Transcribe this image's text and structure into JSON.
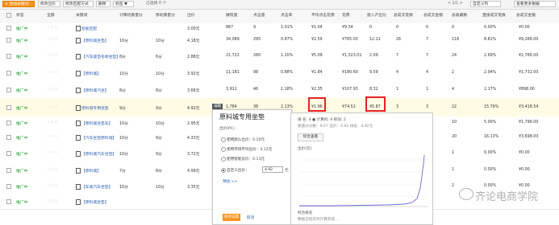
{
  "toolbar": {
    "buttons": [
      "+ 添加关键词",
      "修改出价",
      "修改匹配方式",
      "删除",
      "标签 ▼"
    ],
    "selected": "已选择 0 个",
    "pager": "< 1/1 >",
    "custom_col": "自定义列",
    "more_data": "查看更多数据"
  },
  "columns": [
    "状态",
    "全部",
    "关键词",
    "计算机质量分",
    "移动质量分",
    "出价",
    "展现量",
    "点击量",
    "点击率",
    "平均点击花费",
    "花费",
    "投入产出比",
    "总成交笔数",
    "总成交金额",
    "总收藏数",
    "直接成交笔数",
    "总成交金额"
  ],
  "rows": [
    {
      "status": "推广中",
      "stars": "☆☆☆",
      "keyword": "智能匹配",
      "pc": "",
      "mob": "",
      "bid": "3.00元",
      "imp": "887",
      "clk": "9",
      "ctr": "1.01%",
      "cpc": "¥1.04",
      "cost": "¥9.34",
      "roi": "0",
      "orders": "0",
      "gmv": "0",
      "fav": "0",
      "direct": "0.00%",
      "directgmv": "¥0.00"
    },
    {
      "status": "推广中",
      "stars": "☆☆☆",
      "keyword": "【原料城坐垫】",
      "pc": "10分",
      "mob": "10分",
      "bid": "4.18元",
      "imp": "34,089",
      "clk": "295",
      "ctr": "0.87%",
      "cpc": "¥2.59",
      "cost": "¥765.03",
      "roi": "12.11",
      "orders": "26",
      "gmv": "7",
      "fav": "118",
      "direct": "8.81%",
      "directgmv": "¥9,266.00"
    },
    {
      "status": "推广中",
      "stars": "☆☆☆",
      "keyword": "【汽车座垫冬季坐垫】",
      "pc": "8分",
      "mob": "6分",
      "bid": "2.88元",
      "imp": "21,722",
      "clk": "260",
      "ctr": "1.20%",
      "cpc": "¥5.09",
      "cost": "¥1,323.01",
      "roi": "2.09",
      "orders": "7",
      "gmv": "7",
      "fav": "24",
      "direct": "2.69%",
      "directgmv": "¥2,766.00"
    },
    {
      "status": "推广中",
      "stars": "☆☆☆",
      "keyword": "【原料城】",
      "pc": "10分",
      "mob": "10分",
      "bid": "3.92元",
      "imp": "11,181",
      "clk": "98",
      "ctr": "0.88%",
      "cpc": "¥1.84",
      "cost": "¥180.60",
      "roi": "9.59",
      "orders": "4",
      "gmv": "4",
      "fav": "2",
      "direct": "2.04%",
      "directgmv": "¥1,732.00"
    },
    {
      "status": "推广中",
      "stars": "☆☆☆",
      "keyword": "【原料城汽坐】",
      "pc": "8分",
      "mob": "8分",
      "bid": "3.66元",
      "imp": "3,911",
      "clk": "46",
      "ctr": "1.18%",
      "cpc": "¥2.35",
      "cost": "¥107.93",
      "roi": "8.32",
      "orders": "1",
      "gmv": "1",
      "fav": "4",
      "direct": "2.17%",
      "directgmv": "¥898.00"
    },
    {
      "status": "推广中",
      "stars": "☆☆☆",
      "keyword": "原料城专用坐垫",
      "pc": "9分",
      "mob": "9分",
      "bid": "4.92元",
      "imp": "1,784",
      "clk": "38",
      "ctr": "2.13%",
      "cpc": "¥1.96",
      "cost": "¥74.52",
      "roi": "45.87",
      "orders": "3",
      "gmv": "3",
      "fav": "22",
      "direct": "15.79%",
      "directgmv": "¥3,418.54"
    },
    {
      "status": "推广中",
      "stars": "☆☆☆",
      "keyword": "【原料城坐垫车】",
      "pc": "10分",
      "mob": "10分",
      "bid": "2.95元",
      "imp": "",
      "clk": "",
      "ctr": "",
      "cpc": "",
      "cost": "",
      "roi": "",
      "orders": "",
      "gmv": "",
      "fav": "10",
      "direct": "5.00%",
      "directgmv": "¥1,796.00"
    },
    {
      "status": "推广中",
      "stars": "☆☆☆",
      "keyword": "【汽车坐垫原料城】",
      "pc": "10分",
      "mob": "9分",
      "bid": "4.33元",
      "imp": "",
      "clk": "",
      "ctr": "",
      "cpc": "",
      "cost": "",
      "roi": "",
      "orders": "",
      "gmv": "",
      "fav": "20",
      "direct": "16.13%",
      "directgmv": "¥3,698.00"
    },
    {
      "status": "推广中",
      "stars": "☆☆☆",
      "keyword": "【原料城汽车坐垫】",
      "pc": "10分",
      "mob": "9分",
      "bid": "3.72元",
      "imp": "",
      "clk": "",
      "ctr": "",
      "cpc": "",
      "cost": "",
      "roi": "",
      "orders": "",
      "gmv": "",
      "fav": "1",
      "direct": "0.00%",
      "directgmv": "¥0.00"
    },
    {
      "status": "推广中",
      "stars": "☆☆☆",
      "keyword": "【原料城】",
      "pc": "7分",
      "mob": "8分",
      "bid": "4.99元",
      "imp": "",
      "clk": "",
      "ctr": "",
      "cpc": "",
      "cost": "",
      "roi": "",
      "orders": "",
      "gmv": "",
      "fav": "1",
      "direct": "0.00%",
      "directgmv": "¥0.00"
    },
    {
      "status": "推广中",
      "stars": "☆☆☆",
      "keyword": "【车威汽车坐垫】",
      "pc": "10分",
      "mob": "10分",
      "bid": "3.35元",
      "imp": "",
      "clk": "",
      "ctr": "",
      "cpc": "",
      "cost": "",
      "roi": "",
      "orders": "",
      "gmv": "",
      "fav": "2",
      "direct": "0.00%",
      "directgmv": "¥0.00"
    },
    {
      "status": "推广中",
      "stars": "☆☆☆",
      "keyword": "【原料城坐垫】",
      "pc": "",
      "mob": "",
      "bid": "",
      "imp": "",
      "clk": "",
      "ctr": "",
      "cpc": "",
      "cost": "",
      "roi": "",
      "orders": "",
      "gmv": "",
      "fav": "",
      "direct": "",
      "directgmv": ""
    }
  ],
  "popup": {
    "tag": "编辑",
    "title": "原料城专用坐垫",
    "bid_label": "出价(PC)",
    "options": [
      "使用默认出价：0.10元",
      "使用市场平均出价：3.12元",
      "使用智能竞价：0.13元",
      "自定义出价："
    ],
    "custom_value": "4.92",
    "unit": "元",
    "preview": "预估 >>",
    "save": "保存设置",
    "cancel": "取消"
  },
  "panel": {
    "line1": "排 名: 4 ● 计算机: 9  移动: 2",
    "line2": "质量分分数：9.67  出价：4.92  排名：4.92元",
    "tab": "综合查看",
    "axis": "出价(元)",
    "footer": "综合排名",
    "footer2": "数据已经实时计算完成 ..."
  },
  "watermark": "齐论电商学院"
}
